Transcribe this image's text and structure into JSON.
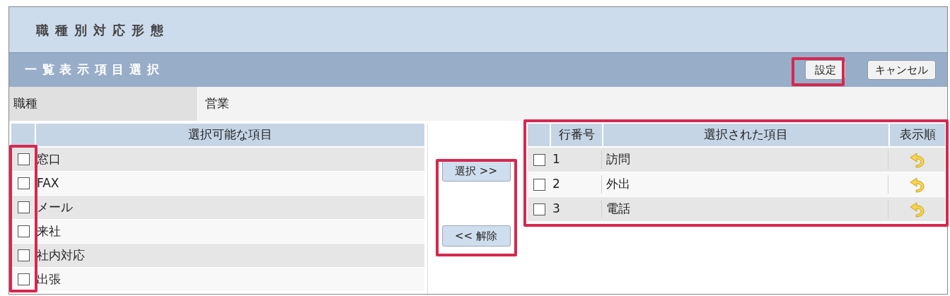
{
  "window": {
    "title": "職種別対応形態"
  },
  "section": {
    "title": "一覧表示項目選択",
    "buttons": [
      {
        "label": "設定",
        "highlighted": true
      },
      {
        "label": "キャンセル",
        "highlighted": false
      }
    ]
  },
  "job_type": {
    "label": "職種",
    "value": "営業"
  },
  "available": {
    "header": "選択可能な項目",
    "checkboxes_highlighted": true,
    "rows": [
      {
        "label": "窓口",
        "checked": false
      },
      {
        "label": "FAX",
        "checked": false
      },
      {
        "label": "メール",
        "checked": false
      },
      {
        "label": "来社",
        "checked": false
      },
      {
        "label": "社内対応",
        "checked": false
      },
      {
        "label": "出張",
        "checked": false
      }
    ]
  },
  "transfer": {
    "highlighted": true,
    "buttons": [
      "選択 >>",
      "<< 解除"
    ]
  },
  "selected": {
    "highlighted": true,
    "columns": [
      "行番号",
      "選択された項目",
      "表示順"
    ],
    "rows": [
      {
        "number": "1",
        "label": "訪問",
        "checked": false
      },
      {
        "number": "2",
        "label": "外出",
        "checked": false
      },
      {
        "number": "3",
        "label": "電話",
        "checked": false
      }
    ]
  }
}
